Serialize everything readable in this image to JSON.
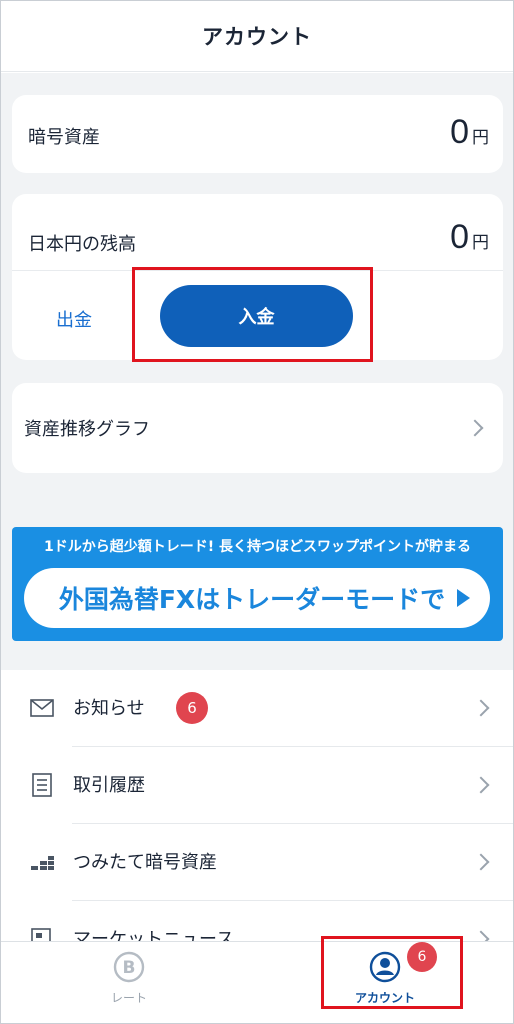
{
  "header": {
    "title": "アカウント"
  },
  "crypto_card": {
    "label": "暗号資産",
    "amount": "0",
    "unit": "円"
  },
  "jpy_card": {
    "label": "日本円の残高",
    "amount": "0",
    "unit": "円",
    "withdraw_label": "出金",
    "deposit_label": "入金"
  },
  "graph_card": {
    "label": "資産推移グラフ"
  },
  "banner": {
    "top_text": "1ドルから超少額トレード! 長く持つほどスワップポイントが貯まる",
    "pill_text": "外国為替FXはトレーダーモードで"
  },
  "list": {
    "items": [
      {
        "label": "お知らせ",
        "icon": "mail-icon",
        "badge": "6"
      },
      {
        "label": "取引履歴",
        "icon": "history-list-icon"
      },
      {
        "label": "つみたて暗号資産",
        "icon": "chart-bars-icon"
      },
      {
        "label": "マーケットニュース",
        "icon": "news-icon"
      }
    ]
  },
  "bottom_nav": {
    "rate_label": "レート",
    "account_label": "アカウント",
    "account_badge": "6"
  },
  "colors": {
    "primary": "#0f60b9",
    "link": "#1a6fd0",
    "banner": "#1a8fe3",
    "badge": "#e0454f",
    "highlight": "#e0141e"
  }
}
